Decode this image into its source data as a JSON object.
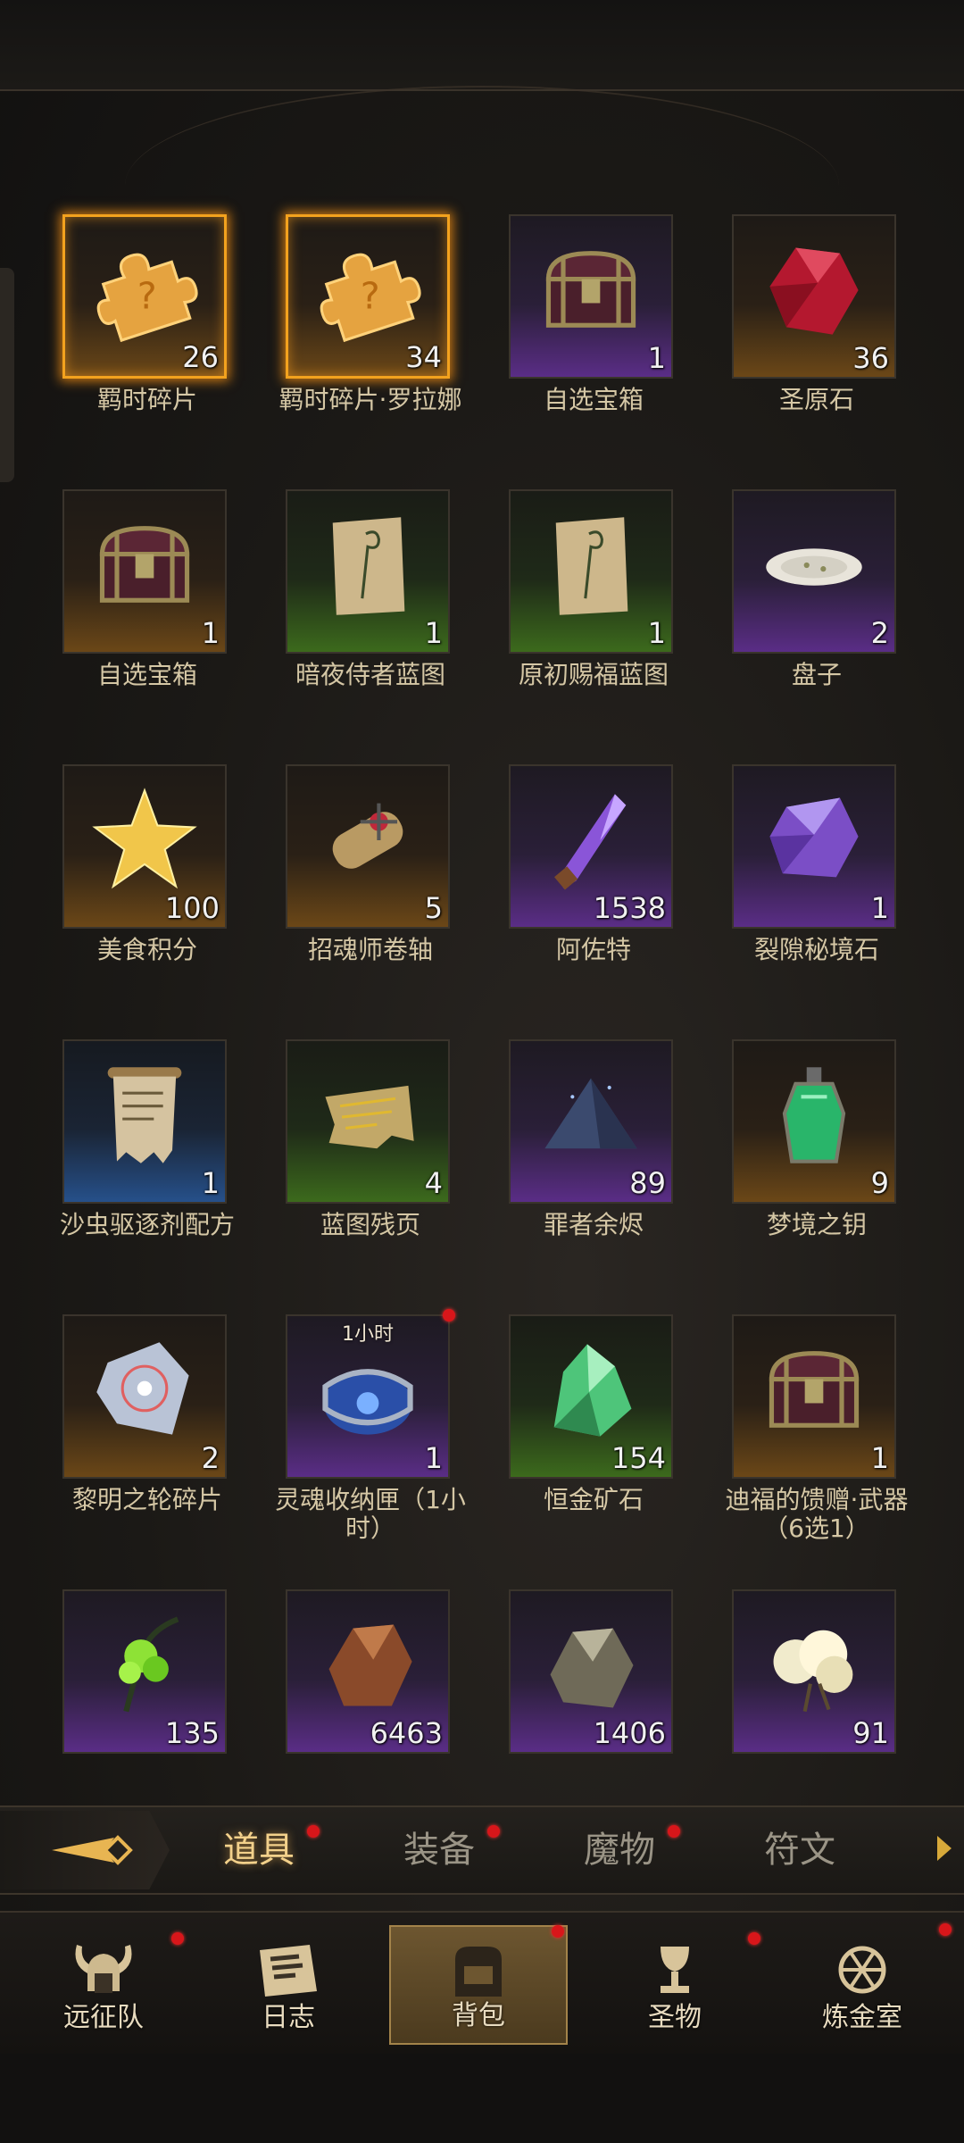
{
  "items": [
    {
      "name": "羁时碎片",
      "count": "26",
      "rarity": "orange",
      "glow": true,
      "icon": "puzzle-piece-icon"
    },
    {
      "name": "羁时碎片·罗拉娜",
      "count": "34",
      "rarity": "orange",
      "glow": true,
      "icon": "puzzle-piece-icon"
    },
    {
      "name": "自选宝箱",
      "count": "1",
      "rarity": "purple",
      "icon": "treasure-chest-icon"
    },
    {
      "name": "圣原石",
      "count": "36",
      "rarity": "orange",
      "icon": "red-gem-icon"
    },
    {
      "name": "自选宝箱",
      "count": "1",
      "rarity": "orange",
      "icon": "treasure-chest-icon"
    },
    {
      "name": "暗夜侍者蓝图",
      "count": "1",
      "rarity": "green",
      "icon": "blueprint-scroll-icon"
    },
    {
      "name": "原初赐福蓝图",
      "count": "1",
      "rarity": "green",
      "icon": "blueprint-scroll-icon"
    },
    {
      "name": "盘子",
      "count": "2",
      "rarity": "purple",
      "icon": "plate-icon"
    },
    {
      "name": "美食积分",
      "count": "100",
      "rarity": "orange",
      "icon": "gold-star-icon"
    },
    {
      "name": "招魂师卷轴",
      "count": "5",
      "rarity": "orange",
      "icon": "rolled-scroll-icon"
    },
    {
      "name": "阿佐特",
      "count": "1538",
      "rarity": "purple",
      "icon": "crystal-vial-icon"
    },
    {
      "name": "裂隙秘境石",
      "count": "1",
      "rarity": "purple",
      "icon": "purple-crystal-icon"
    },
    {
      "name": "沙虫驱逐剂配方",
      "count": "1",
      "rarity": "blue",
      "icon": "recipe-scroll-icon"
    },
    {
      "name": "蓝图残页",
      "count": "4",
      "rarity": "green",
      "icon": "torn-page-icon"
    },
    {
      "name": "罪者余烬",
      "count": "89",
      "rarity": "purple",
      "icon": "ash-pile-icon"
    },
    {
      "name": "梦境之钥",
      "count": "9",
      "rarity": "orange",
      "icon": "green-potion-icon"
    },
    {
      "name": "黎明之轮碎片",
      "count": "2",
      "rarity": "orange",
      "icon": "shard-icon"
    },
    {
      "name": "灵魂收纳匣（1小时）",
      "count": "1",
      "rarity": "purple",
      "icon": "soul-box-icon",
      "timer": "1小时",
      "badge": true
    },
    {
      "name": "恒金矿石",
      "count": "154",
      "rarity": "green",
      "icon": "green-ore-icon"
    },
    {
      "name": "迪福的馈赠·武器（6选1）",
      "count": "1",
      "rarity": "orange",
      "icon": "treasure-chest-icon"
    },
    {
      "name": "",
      "count": "135",
      "rarity": "purple",
      "icon": "green-spore-icon"
    },
    {
      "name": "",
      "count": "6463",
      "rarity": "purple",
      "icon": "brown-ore-icon"
    },
    {
      "name": "",
      "count": "1406",
      "rarity": "purple",
      "icon": "grey-ore-icon"
    },
    {
      "name": "",
      "count": "91",
      "rarity": "purple",
      "icon": "cloud-flower-icon"
    }
  ],
  "tabs": [
    {
      "label": "道具",
      "active": true,
      "badge": true
    },
    {
      "label": "装备",
      "active": false,
      "badge": true
    },
    {
      "label": "魔物",
      "active": false,
      "badge": true
    },
    {
      "label": "符文",
      "active": false,
      "badge": false
    }
  ],
  "nav": [
    {
      "label": "远征队",
      "icon": "viking-helmet-icon",
      "badge": true
    },
    {
      "label": "日志",
      "icon": "journal-icon",
      "badge": false
    },
    {
      "label": "背包",
      "icon": "backpack-icon",
      "active": true,
      "badge": true
    },
    {
      "label": "圣物",
      "icon": "chalice-icon",
      "badge": true
    },
    {
      "label": "炼金室",
      "icon": "alchemy-icon",
      "badge": true
    }
  ],
  "colors": {
    "accent": "#f3a21e",
    "badge": "#d8161a",
    "tab_active": "#f3d18b"
  }
}
